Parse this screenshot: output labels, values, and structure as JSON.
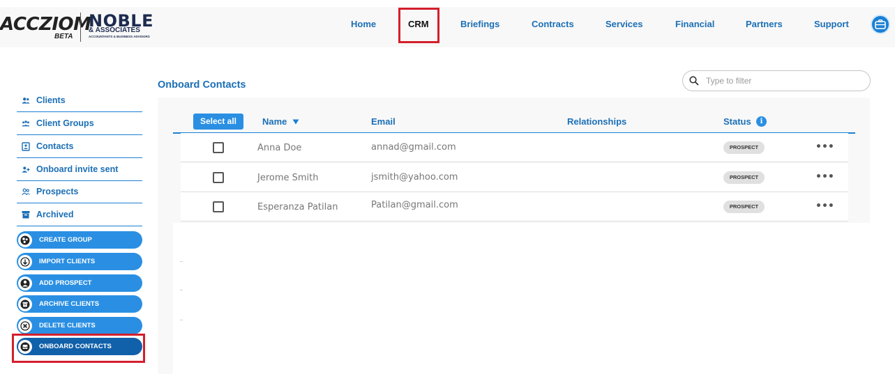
{
  "brand": {
    "app_name": "ACCZIOM",
    "app_badge": "BETA",
    "partner_name": "NOBLE",
    "partner_sub": "& ASSOCIATES",
    "partner_tagline": "ACCOUNTANTS & BUSINESS ADVISORS"
  },
  "nav": [
    {
      "label": "Home"
    },
    {
      "label": "CRM"
    },
    {
      "label": "Briefings"
    },
    {
      "label": "Contracts"
    },
    {
      "label": "Services"
    },
    {
      "label": "Financial"
    },
    {
      "label": "Partners"
    },
    {
      "label": "Support"
    }
  ],
  "sidebar": {
    "links": [
      {
        "label": "Clients",
        "icon": "users-icon"
      },
      {
        "label": "Client Groups",
        "icon": "client-groups-icon"
      },
      {
        "label": "Contacts",
        "icon": "contacts-icon"
      },
      {
        "label": "Onboard invite sent",
        "icon": "user-plus-icon"
      },
      {
        "label": "Prospects",
        "icon": "prospects-icon"
      },
      {
        "label": "Archived",
        "icon": "archive-icon"
      }
    ],
    "actions": [
      {
        "label": "CREATE GROUP",
        "icon": "group-circles-icon"
      },
      {
        "label": "IMPORT CLIENTS",
        "icon": "arrow-down-icon"
      },
      {
        "label": "ADD PROSPECT",
        "icon": "person-icon"
      },
      {
        "label": "ARCHIVE CLIENTS",
        "icon": "archive-box-icon"
      },
      {
        "label": "DELETE CLIENTS",
        "icon": "close-icon"
      },
      {
        "label": "ONBOARD CONTACTS",
        "icon": "inbox-icon"
      }
    ]
  },
  "main": {
    "title": "Onboard Contacts",
    "filter_placeholder": "Type to filter",
    "select_all_label": "Select all",
    "columns": {
      "name": "Name",
      "email": "Email",
      "relationships": "Relationships",
      "status": "Status"
    },
    "sort_icon": "sort-down-icon",
    "status_info_icon": "info-icon",
    "rows": [
      {
        "name": "Anna Doe",
        "email": "annad@gmail.com",
        "status": "PROSPECT"
      },
      {
        "name": "Jerome Smith",
        "email": "jsmith@yahoo.com",
        "status": "PROSPECT"
      },
      {
        "name": "Esperanza Patilan",
        "email": "Patilan@gmail.com",
        "status": "PROSPECT"
      }
    ],
    "more_label": "•••"
  },
  "colors": {
    "accent": "#1b6fb6",
    "button": "#2a8fe3",
    "button_active": "#1160aa",
    "highlight": "#d41f2c",
    "panel": "#f8f8f8"
  }
}
